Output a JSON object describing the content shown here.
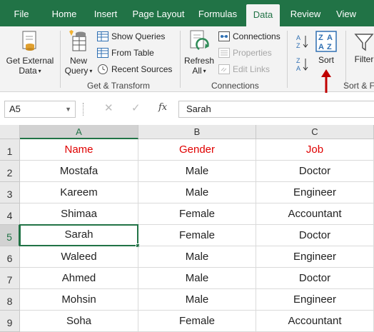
{
  "tabs": [
    "File",
    "Home",
    "Insert",
    "Page Layout",
    "Formulas",
    "Data",
    "Review",
    "View"
  ],
  "active_tab": "Data",
  "ribbon": {
    "get_external_data": [
      "Get External",
      "Data"
    ],
    "new_query": [
      "New",
      "Query"
    ],
    "show_queries": "Show Queries",
    "from_table": "From Table",
    "recent_sources": "Recent Sources",
    "get_transform_label": "Get & Transform",
    "refresh_all": [
      "Refresh",
      "All"
    ],
    "connections": "Connections",
    "properties": "Properties",
    "edit_links": "Edit Links",
    "connections_group_label": "Connections",
    "sort": "Sort",
    "filter": "Filter",
    "sort_filter_label": "Sort & F"
  },
  "formula_bar": {
    "name_box": "A5",
    "cancel": "✕",
    "enter": "✓",
    "fx": "fx",
    "content": "Sarah"
  },
  "accent_color": "#217346",
  "arrow_color": "#c00000",
  "sheet": {
    "columns": [
      "A",
      "B",
      "C"
    ],
    "rows": [
      "1",
      "2",
      "3",
      "4",
      "5",
      "6",
      "7",
      "8",
      "9"
    ],
    "selected_cell": "A5",
    "cells": [
      [
        "Name",
        "Gender",
        "Job"
      ],
      [
        "Mostafa",
        "Male",
        "Doctor"
      ],
      [
        "Kareem",
        "Male",
        "Engineer"
      ],
      [
        "Shimaa",
        "Female",
        "Accountant"
      ],
      [
        "Sarah",
        "Female",
        "Doctor"
      ],
      [
        "Waleed",
        "Male",
        "Engineer"
      ],
      [
        "Ahmed",
        "Male",
        "Doctor"
      ],
      [
        "Mohsin",
        "Male",
        "Engineer"
      ],
      [
        "Soha",
        "Female",
        "Accountant"
      ]
    ]
  }
}
